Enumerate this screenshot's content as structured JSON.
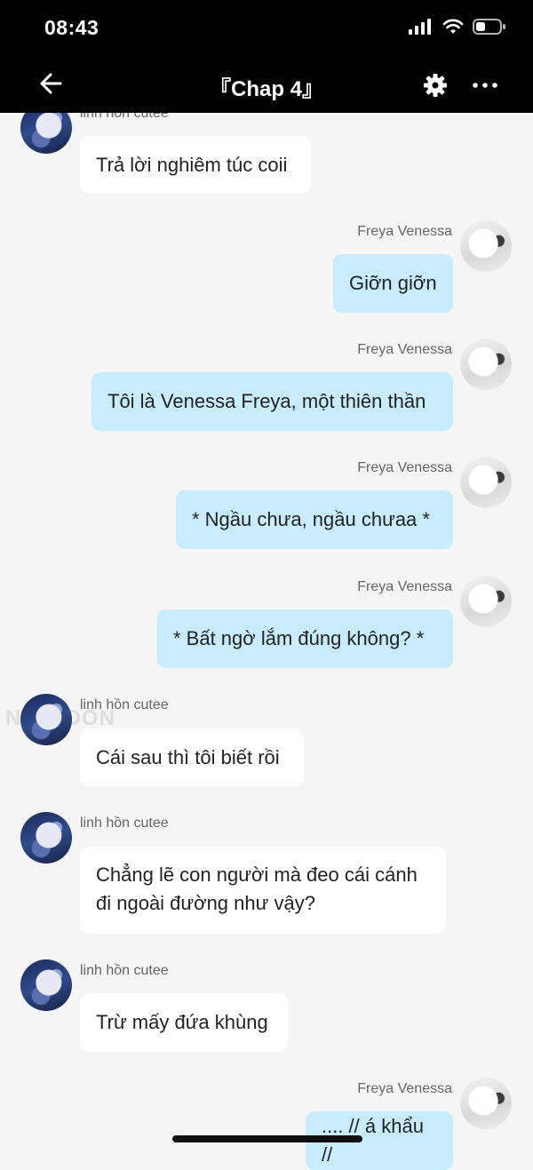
{
  "status": {
    "time": "08:43"
  },
  "nav": {
    "title": "『Chap 4』"
  },
  "watermark": "NETTOON",
  "messages": [
    {
      "sender": "linh hồn cutee",
      "text": "Trả lời nghiêm túc coii"
    },
    {
      "sender": "Freya Venessa",
      "text": "Giỡn giỡn"
    },
    {
      "sender": "Freya Venessa",
      "text": "Tôi là Venessa Freya, một thiên thần"
    },
    {
      "sender": "Freya Venessa",
      "text": "* Ngầu chưa, ngầu chưaa *"
    },
    {
      "sender": "Freya Venessa",
      "text": "* Bất ngờ lắm đúng không? *"
    },
    {
      "sender": "linh hồn cutee",
      "text": "Cái sau thì tôi biết rồi"
    },
    {
      "sender": "linh hồn cutee",
      "text": "Chẳng lẽ con người mà đeo cái cánh đi ngoài đường như vậy?"
    },
    {
      "sender": "linh hồn cutee",
      "text": "Trừ mấy đứa khùng"
    },
    {
      "sender": "Freya Venessa",
      "text": ".... // á khẩu //"
    }
  ]
}
